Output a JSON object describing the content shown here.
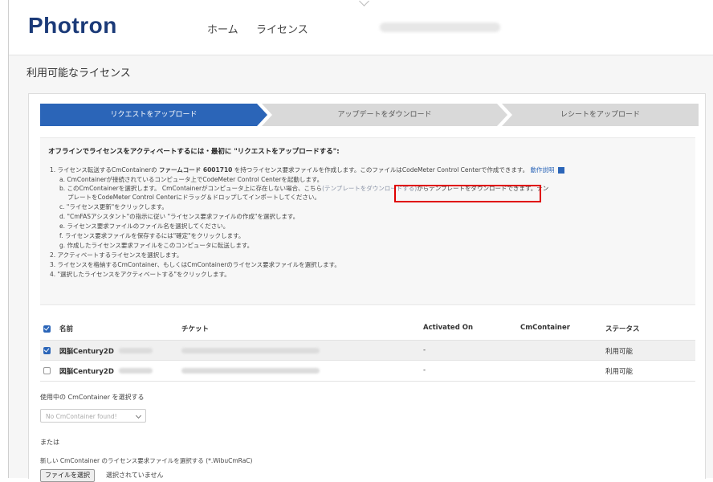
{
  "header": {
    "logo": "Photron",
    "nav": [
      "ホーム",
      "ライセンス"
    ]
  },
  "page": {
    "title": "利用可能なライセンス"
  },
  "steps": [
    {
      "label": "リクエストをアップロード",
      "active": true
    },
    {
      "label": "アップデートをダウンロード",
      "active": false
    },
    {
      "label": "レシートをアップロード",
      "active": false
    }
  ],
  "instructions": {
    "title": "オフラインでライセンスをアクティベートするには・最初に \"リクエストをアップロードする\":",
    "l1a": "1. ライセンス転送するCmContainerの ",
    "l1b": "ファームコード 6001710",
    "l1c": " を持つライセンス要求ファイルを作成します。このファイルはCodeMeter Control Centerで作成できます。",
    "l1link": "動作説明",
    "la": "a. CmContainerが接続されているコンピュータ上でCodeMeter Control Centerを起動します。",
    "lb1": "b. このCmContainerを選択します。 CmContainerがコンピュータ上に存在しない場合、こちら",
    "lb_link": "(テンプレートをダウンロードする)",
    "lb2": "からテンプレートをダウンロードできます。テン",
    "lb3": "プレートをCodeMeter Control Centerにドラッグ＆ドロップしてインポートしてください。",
    "lc": "c. \"ライセンス更新\"をクリックします。",
    "ld": "d. \"CmFASアシスタント\"の指示に従い \"ライセンス要求ファイルの作成\"を選択します。",
    "le": "e. ライセンス要求ファイルのファイル名を選択してください。",
    "lf": "f. ライセンス要求ファイルを保存するには\"確定\"をクリックします。",
    "lg": "g. 作成したライセンス要求ファイルをこのコンピュータに転送します。",
    "l2": "2. アクティベートするライセンスを選択します。",
    "l3": "3. ライセンスを格納するCmContainer、もしくはCmContainerのライセンス要求ファイルを選択します。",
    "l4": "4. \"選択したライセンスをアクティベートする\"をクリックします。"
  },
  "table": {
    "headers": {
      "name": "名前",
      "ticket": "チケット",
      "activated": "Activated On",
      "container": "CmContainer",
      "status": "ステータス"
    },
    "rows": [
      {
        "name": "図脳Century2D",
        "activated": "-",
        "status": "利用可能",
        "checked": true
      },
      {
        "name": "図脳Century2D",
        "activated": "-",
        "status": "利用可能",
        "checked": false
      }
    ]
  },
  "container_select": {
    "label": "使用中の CmContainer を選択する",
    "value": "No CmContainer found!"
  },
  "or_label": "または",
  "file_select": {
    "label": "新しい CmContainer のライセンス要求ファイルを選択する (*.WibuCmRaC)",
    "button": "ファイルを選択",
    "status": "選択されていません"
  }
}
